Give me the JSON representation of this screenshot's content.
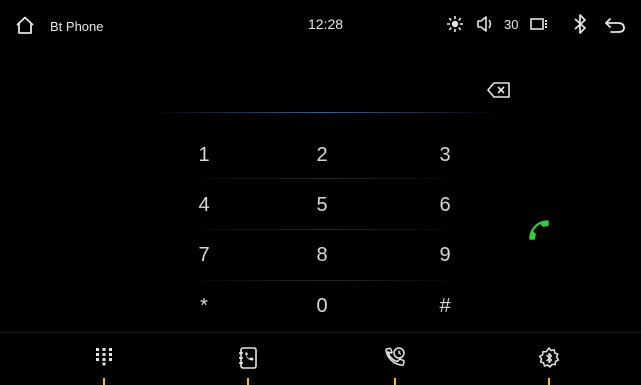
{
  "header": {
    "title": "Bt Phone",
    "time": "12:28",
    "volume": "30"
  },
  "dialer": {
    "number": "",
    "keys": [
      "1",
      "2",
      "3",
      "4",
      "5",
      "6",
      "7",
      "8",
      "9",
      "*",
      "0",
      "#"
    ]
  },
  "nav": {
    "tabs": [
      "keypad-icon",
      "contacts-icon",
      "recent-calls-icon",
      "settings-icon"
    ],
    "active_indicator_color": "#f1c40f"
  },
  "colors": {
    "call": "#2ecc40",
    "accent": "#f1c40f",
    "divider": "#3c6ea0"
  }
}
